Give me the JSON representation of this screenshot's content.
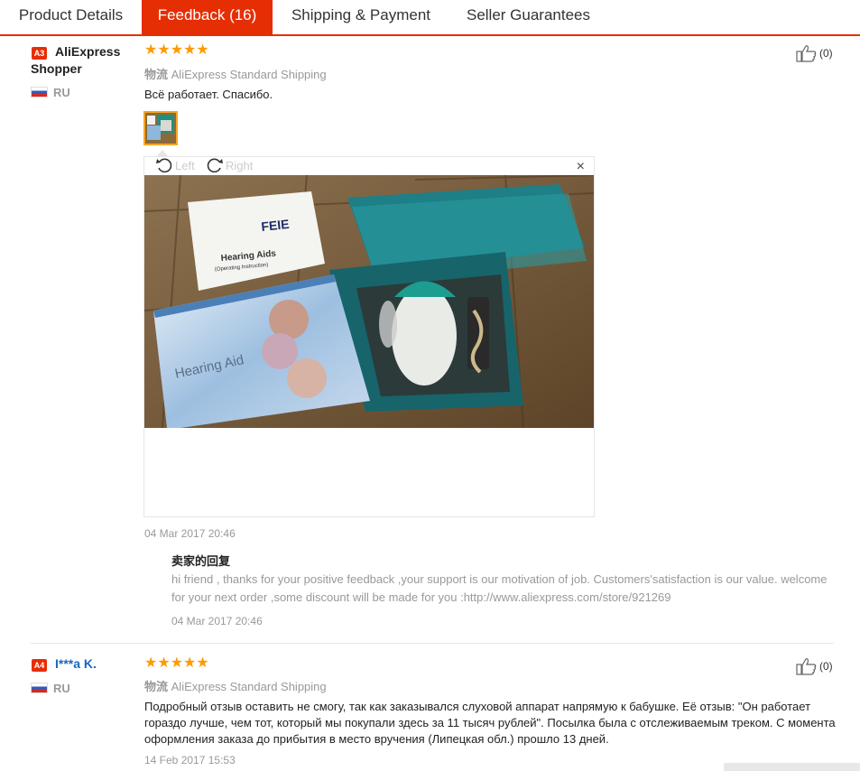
{
  "tabs": [
    {
      "label": "Product Details",
      "active": false
    },
    {
      "label": "Feedback (16)",
      "active": true
    },
    {
      "label": "Shipping & Payment",
      "active": false
    },
    {
      "label": "Seller Guarantees",
      "active": false
    }
  ],
  "reviews": [
    {
      "level": "A3",
      "name": "AliExpress Shopper",
      "country": "RU",
      "stars": "★★★★★",
      "rating": 5,
      "shipping_prefix": "物流",
      "shipping": "AliExpress Standard Shipping",
      "text": "Всё работает. Спасибо.",
      "like_count": "(0)",
      "date": "04 Mar 2017 20:46",
      "viewer": {
        "left_label": "Left",
        "right_label": "Right",
        "close": "×"
      },
      "photo_text": {
        "brand": "FEIE",
        "leaflet_title": "Hearing Aids",
        "leaflet_sub": "(Operating Instruction)",
        "box_title": "Hearing Aid"
      },
      "seller_reply": {
        "title": "卖家的回复",
        "text": "hi friend , thanks for your positive feedback ,your support is our motivation of job. Customers'satisfaction is our value. welcome for your next order ,some discount will be made for you :http://www.aliexpress.com/store/921269",
        "date": "04 Mar 2017 20:46"
      }
    },
    {
      "level": "A4",
      "name": "I***a K.",
      "country": "RU",
      "stars": "★★★★★",
      "rating": 5,
      "shipping_prefix": "物流",
      "shipping": "AliExpress Standard Shipping",
      "text": "Подробный отзыв оставить не смогу, так как заказывался слуховой аппарат напрямую к бабушке. Её отзыв: \"Он работает гораздо лучше, чем тот, который мы покупали здесь за 11 тысяч рублей\". Посылка была с отслеживаемым треком. С момента оформления заказа до прибытия в место вручения (Липецкая обл.) прошло 13 дней.",
      "like_count": "(0)",
      "date": "14 Feb 2017 15:53"
    }
  ],
  "colors": {
    "accent": "#e62e04",
    "star": "#ff9a00",
    "link": "#1a67c2"
  }
}
